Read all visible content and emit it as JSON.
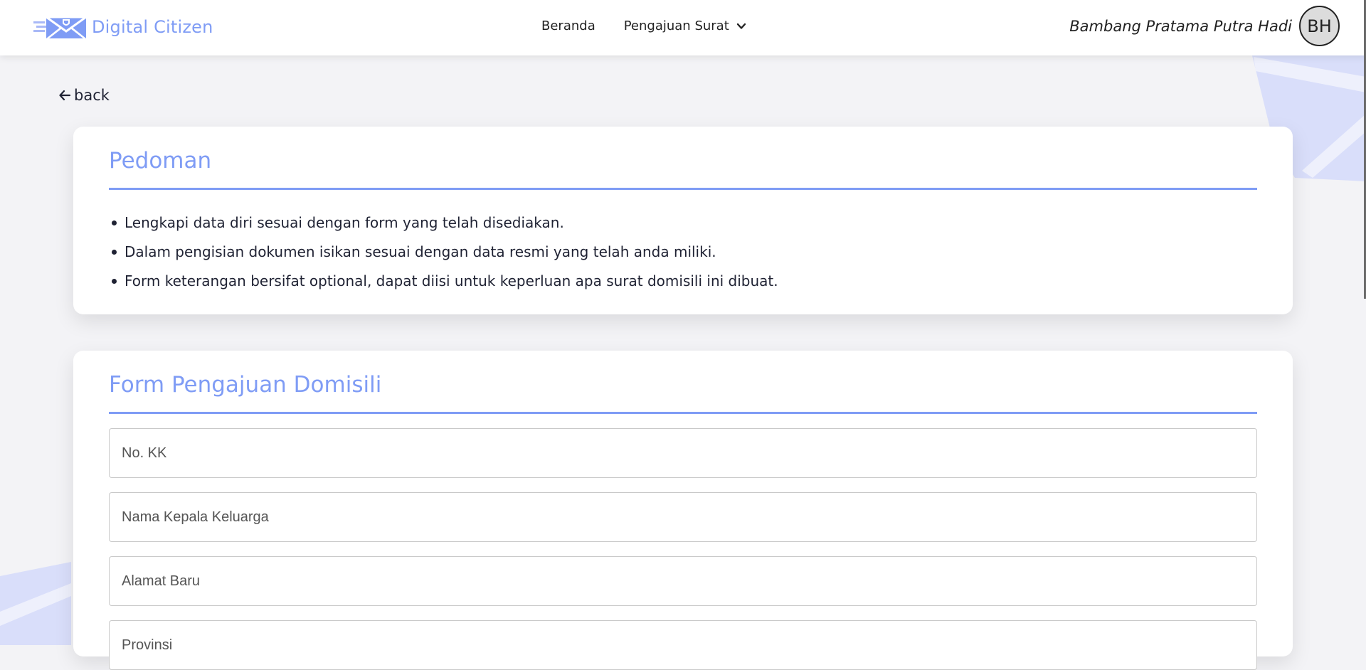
{
  "brand": {
    "name": "Digital Citizen",
    "logo_icon": "envelope-shield-logo",
    "accent_color": "#7f9cf5"
  },
  "nav": {
    "items": [
      {
        "label": "Beranda"
      },
      {
        "label": "Pengajuan Surat",
        "icon": "chevron-down-icon"
      }
    ]
  },
  "user": {
    "name": "Bambang Pratama Putra Hadi",
    "initials": "BH"
  },
  "back": {
    "label": "back",
    "icon": "arrow-left-icon"
  },
  "guide": {
    "title": "Pedoman",
    "items": [
      "Lengkapi data diri sesuai dengan form yang telah disediakan.",
      "Dalam pengisian dokumen isikan sesuai dengan data resmi yang telah anda miliki.",
      "Form keterangan bersifat optional, dapat diisi untuk keperluan apa surat domisili ini dibuat."
    ]
  },
  "form": {
    "title": "Form Pengajuan Domisili",
    "fields": [
      {
        "placeholder": "No. KK",
        "value": ""
      },
      {
        "placeholder": "Nama Kepala Keluarga",
        "value": ""
      },
      {
        "placeholder": "Alamat Baru",
        "value": ""
      },
      {
        "placeholder": "Provinsi",
        "value": ""
      }
    ]
  }
}
